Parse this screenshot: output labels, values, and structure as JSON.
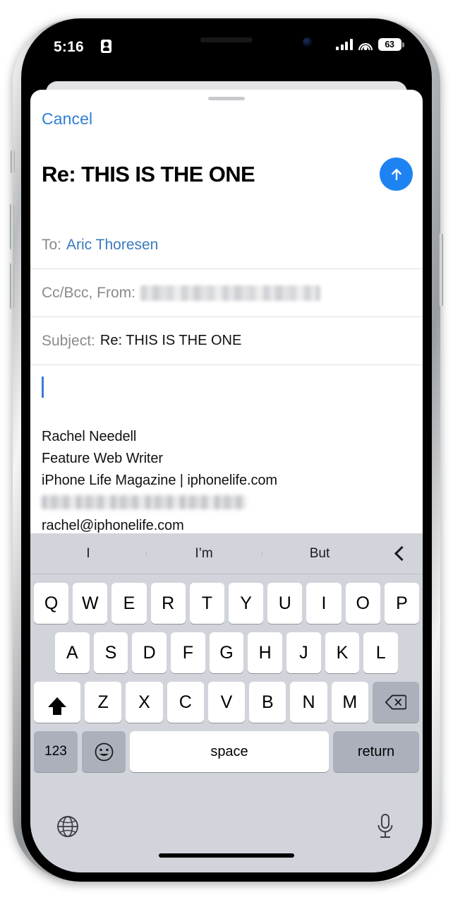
{
  "status_bar": {
    "time": "5:16",
    "lock_icon": "lock-portrait-icon",
    "signal_icon": "cellular-signal-icon",
    "wifi_icon": "wifi-icon",
    "battery_level": "63"
  },
  "sheet": {
    "grabber": "sheet-grabber",
    "cancel_label": "Cancel",
    "compose_title": "Re: THIS IS THE ONE",
    "send_icon": "send-arrow-up-icon"
  },
  "fields": {
    "to_label": "To:",
    "to_value": "Aric Thoresen",
    "ccbcc_label": "Cc/Bcc, From:",
    "ccbcc_value_redacted": "",
    "subject_label": "Subject:",
    "subject_value": "Re: THIS IS THE ONE"
  },
  "body": {
    "signature": [
      "Rachel Needell",
      "Feature Web Writer",
      "iPhone Life Magazine | iphonelife.com"
    ],
    "redacted_email": "",
    "email": "rachel@iphonelife.com"
  },
  "keyboard": {
    "predictions": [
      "I",
      "I’m",
      "But"
    ],
    "collapse_icon": "chevron-left-icon",
    "row1": [
      "Q",
      "W",
      "E",
      "R",
      "T",
      "Y",
      "U",
      "I",
      "O",
      "P"
    ],
    "row2": [
      "A",
      "S",
      "D",
      "F",
      "G",
      "H",
      "J",
      "K",
      "L"
    ],
    "row3": [
      "Z",
      "X",
      "C",
      "V",
      "B",
      "N",
      "M"
    ],
    "shift_icon": "shift-up-arrow-icon",
    "delete_icon": "delete-backspace-icon",
    "numbers_label": "123",
    "emoji_icon": "emoji-smiley-icon",
    "space_label": "space",
    "return_label": "return",
    "globe_icon": "globe-language-icon",
    "mic_icon": "microphone-dictation-icon"
  },
  "colors": {
    "accent_blue": "#1d83f2",
    "link_blue": "#2f7fd6",
    "keyboard_bg": "#d1d4db"
  }
}
